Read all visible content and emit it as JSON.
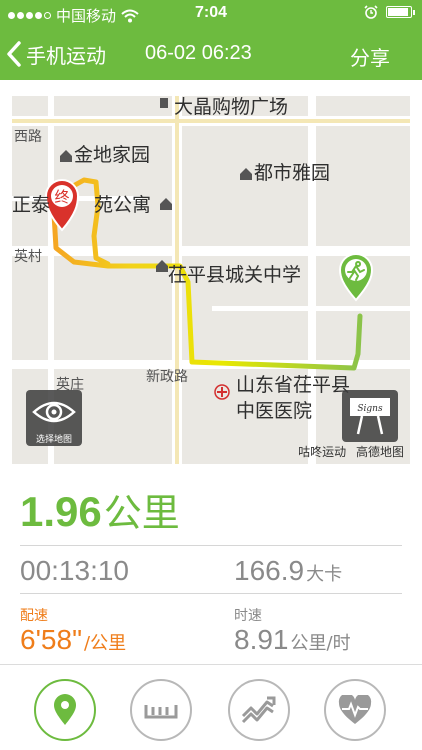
{
  "status_bar": {
    "carrier": "中国移动",
    "time": "7:04"
  },
  "header": {
    "back_label": "手机运动",
    "datetime": "06-02 06:23",
    "share_label": "分享"
  },
  "map": {
    "labels": {
      "poi_top": "大晶购物广场",
      "road_left": "西路",
      "jindi": "金地家园",
      "dushi": "都市雅园",
      "zhengtai": "正泰",
      "yuan_gongyu": "苑公寓",
      "yingcun": "英村",
      "school": "茌平县城关中学",
      "yingzhuang": "英庄",
      "xinzheng": "新政路",
      "hospital_1": "山东省茌平县",
      "hospital_2": "中医医院"
    },
    "end_marker_text": "终",
    "eye_button_caption": "选择地图",
    "sign_text": "Signs",
    "credit_app": "咕咚运动",
    "credit_map": "高德地图",
    "route_colors": {
      "start": "#8bc34a",
      "middle": "#e8e800",
      "end": "#f5a623"
    }
  },
  "summary": {
    "distance_value": "1.96",
    "distance_unit": "公里",
    "duration": "00:13:10",
    "calories_value": "166.9",
    "calories_unit": "大卡",
    "pace_label": "配速",
    "pace_value": "6'58\"",
    "pace_unit": "/公里",
    "speed_label": "时速",
    "speed_value": "8.91",
    "speed_unit": "公里/时"
  },
  "tabs": [
    {
      "icon": "location-pin-icon",
      "active": true
    },
    {
      "icon": "ruler-icon",
      "active": false
    },
    {
      "icon": "trend-chart-icon",
      "active": false
    },
    {
      "icon": "heart-rate-icon",
      "active": false
    }
  ],
  "colors": {
    "brand_green": "#6dbb3f",
    "accent_orange": "#ef7d1a",
    "text_gray": "#8a8a8a"
  }
}
